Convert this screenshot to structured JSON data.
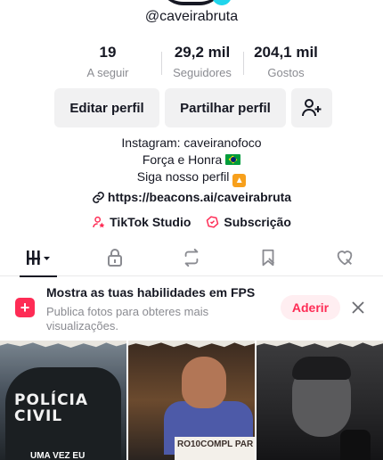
{
  "profile": {
    "username": "@caveirabruta"
  },
  "stats": [
    {
      "value": "19",
      "label": "A seguir"
    },
    {
      "value": "29,2 mil",
      "label": "Seguidores"
    },
    {
      "value": "204,1 mil",
      "label": "Gostos"
    }
  ],
  "actions": {
    "edit_profile": "Editar perfil",
    "share_profile": "Partilhar perfil",
    "add_friend_icon": "person-add-icon"
  },
  "bio": {
    "line1": "Instagram: caveiranofoco",
    "line2": "Força e Honra",
    "line3": "Siga nosso perfil"
  },
  "link": {
    "url": "https://beacons.ai/caveirabruta"
  },
  "shortcuts": {
    "studio": "TikTok Studio",
    "subscription": "Subscrição"
  },
  "tabs": [
    {
      "icon": "videos-grid-icon",
      "active": true
    },
    {
      "icon": "lock-icon",
      "active": false
    },
    {
      "icon": "repost-icon",
      "active": false
    },
    {
      "icon": "saved-icon",
      "active": false
    },
    {
      "icon": "liked-icon",
      "active": false
    }
  ],
  "promo": {
    "title": "Mostra as tuas habilidades em FPS",
    "subtitle": "Publica fotos para obteres mais visualizações.",
    "join_label": "Aderir"
  },
  "videos": [
    {
      "overlay_text": "POLÍCIA\nCIVIL",
      "caption": "UMA VEZ EU"
    },
    {
      "overlay_text": "RO10COMPL PAR"
    },
    {
      "overlay_text": ""
    }
  ],
  "colors": {
    "accent": "#fe2c55",
    "text": "#161823",
    "muted": "#8a8b91",
    "button_bg": "#f1f1f2"
  }
}
